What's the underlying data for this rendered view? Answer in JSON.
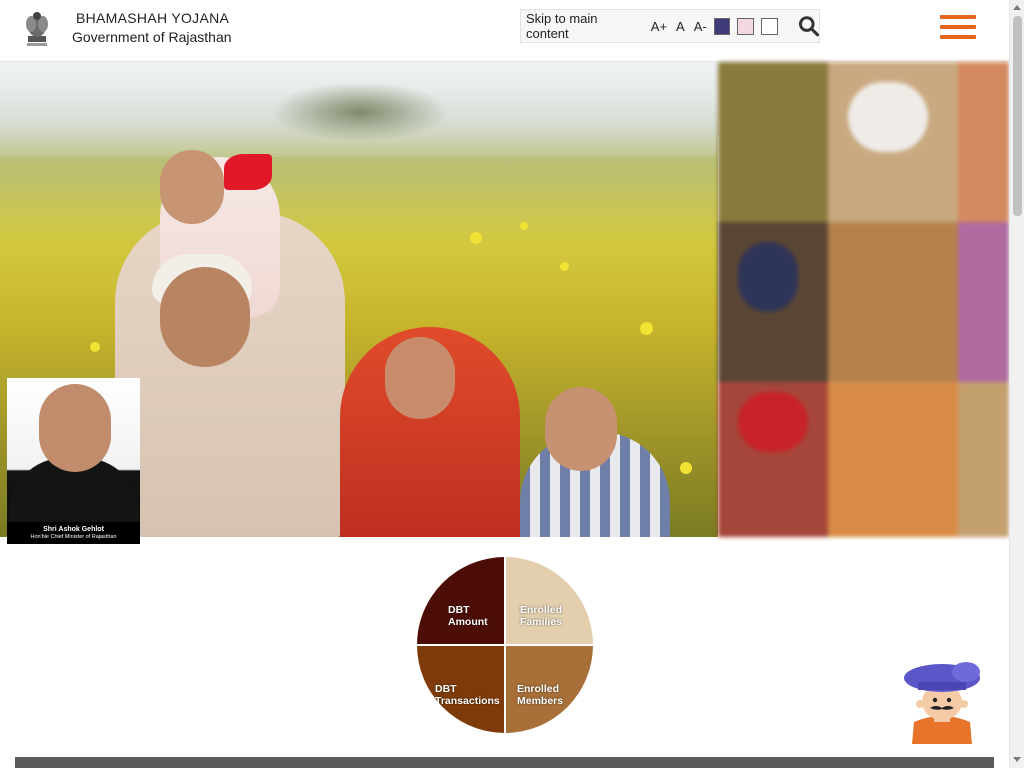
{
  "header": {
    "title_line1": "BHAMASHAH YOJANA",
    "title_line2": "Government of Rajasthan",
    "logo_icon": "ashoka-emblem-icon"
  },
  "toolbar": {
    "skip_link": "Skip to main content",
    "font_increase": "A+",
    "font_normal": "A",
    "font_decrease": "A-",
    "theme_swatches": [
      "#3f3a7a",
      "#f3d8df",
      "#ffffff"
    ],
    "search_icon": "search-icon"
  },
  "menu": {
    "icon": "hamburger-menu-icon",
    "color": "#e3651d"
  },
  "hero": {
    "cm_name": "Shri Ashok Gehlot",
    "cm_role": "Hon'ble Chief Minister of Rajasthan"
  },
  "stats": {
    "items": [
      {
        "label_line1": "DBT",
        "label_line2": "Amount",
        "color": "#4c0d05"
      },
      {
        "label_line1": "Enrolled",
        "label_line2": "Families",
        "color": "#e3cfad"
      },
      {
        "label_line1": "DBT",
        "label_line2": "Transactions",
        "color": "#7e3b09"
      },
      {
        "label_line1": "Enrolled",
        "label_line2": "Members",
        "color": "#a87038"
      }
    ]
  },
  "assistant": {
    "icon": "chatbot-mascot-icon"
  }
}
